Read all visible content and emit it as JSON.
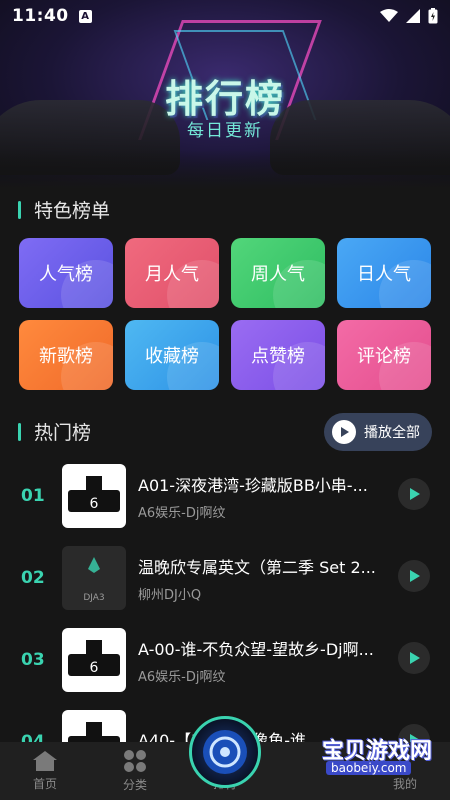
{
  "status_bar": {
    "time": "11:40",
    "notification_badge": "A"
  },
  "banner": {
    "title": "排行榜",
    "subtitle": "每日更新"
  },
  "featured": {
    "heading": "特色榜单",
    "tiles": [
      {
        "label": "人气榜",
        "color_from": "#7f6cf4",
        "color_to": "#5a52e0"
      },
      {
        "label": "月人气",
        "color_from": "#f06a7e",
        "color_to": "#e0506a"
      },
      {
        "label": "周人气",
        "color_from": "#52d67a",
        "color_to": "#2fbd62"
      },
      {
        "label": "日人气",
        "color_from": "#4aa8f5",
        "color_to": "#2b86e8"
      },
      {
        "label": "新歌榜",
        "color_from": "#ff8a3d",
        "color_to": "#f06a2a"
      },
      {
        "label": "收藏榜",
        "color_from": "#4fb8f2",
        "color_to": "#2d92e6"
      },
      {
        "label": "点赞榜",
        "color_from": "#9a6cf2",
        "color_to": "#7b4fe6"
      },
      {
        "label": "评论榜",
        "color_from": "#f36ba6",
        "color_to": "#e44e8e"
      }
    ]
  },
  "hot": {
    "heading": "热门榜",
    "play_all_label": "播放全部",
    "items": [
      {
        "rank": "01",
        "title": "A01-深夜港湾-珍藏版BB小串-...",
        "artist": "A6娱乐-Dj啊纹",
        "cover": "light"
      },
      {
        "rank": "02",
        "title": "温晚欣专属英文（第二季 Set 2...",
        "artist": "柳州DJ小Q",
        "cover": "dark",
        "cover_text": "DJA3"
      },
      {
        "rank": "03",
        "title": "A-00-谁-不负众望-望故乡-Dj啊...",
        "artist": "A6娱乐-Dj啊纹",
        "cover": "light"
      },
      {
        "rank": "04",
        "title": "A40-【FI...记】像鱼-谁...",
        "artist": "",
        "cover": "light"
      }
    ]
  },
  "nav": {
    "items": [
      {
        "label": "首页",
        "icon": "home-icon"
      },
      {
        "label": "分类",
        "icon": "category-icon"
      },
      {
        "label": "排行",
        "icon": "rank-icon"
      },
      {
        "label": "",
        "icon": ""
      },
      {
        "label": "我的",
        "icon": "profile-icon"
      }
    ]
  },
  "watermark": {
    "title": "宝贝游戏网",
    "url": "baobeiy.com"
  },
  "colors": {
    "accent": "#3ad3b0",
    "background": "#161616"
  }
}
